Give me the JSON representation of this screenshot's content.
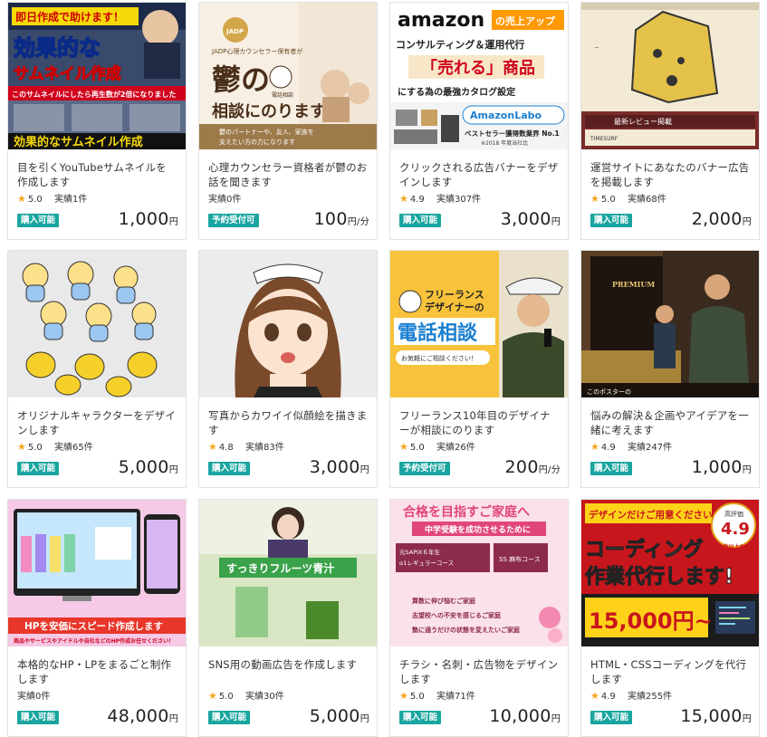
{
  "services": [
    {
      "title": "目を引くYouTubeサムネイルを作成します",
      "rating": "5.0",
      "sales_prefix": "実績",
      "sales_count": "1件",
      "badge": "購入可能",
      "price": "1,000",
      "unit": "円",
      "thumb": {
        "line1": "即日作成で助けます！",
        "line2": "効果的な",
        "line3": "サムネイル作成",
        "line4": "このサムネイルにしたら再生数が2倍になりました",
        "line5": "効果的なサムネイル作成"
      }
    },
    {
      "title": "心理カウンセラー資格者が鬱のお話を聞きます",
      "rating": "",
      "sales_prefix": "実績",
      "sales_count": "0件",
      "badge": "予約受付可",
      "price": "100",
      "unit": "円/分",
      "thumb": {
        "line1": "JADP心理カウンセラー保有者が",
        "line2": "鬱の",
        "line3": "相談にのります",
        "line4": "鬱のパートナーや、友人、家族を",
        "line5": "支えたい方の力になります",
        "line6": "電話相談",
        "seal": "JADP"
      }
    },
    {
      "title": "クリックされる広告バナーをデザインします",
      "rating": "4.9",
      "sales_prefix": "実績",
      "sales_count": "307件",
      "badge": "購入可能",
      "price": "3,000",
      "unit": "円",
      "thumb": {
        "line1": "amazon",
        "line2": "の売上アップ",
        "line3": "コンサルティング＆運用代行",
        "line4": "「売れる」商品",
        "line5": "にする為の最強カタログ設定",
        "line6": "AmazonLabo",
        "line7": "ベストセラー獲得数業界 No.1",
        "line8": "※2018 年度当社比"
      }
    },
    {
      "title": "運営サイトにあなたのバナー広告を掲載します",
      "rating": "5.0",
      "sales_prefix": "実績",
      "sales_count": "68件",
      "badge": "購入可能",
      "price": "2,000",
      "unit": "円",
      "thumb": {
        "line1": "最新レビュー掲載",
        "line2": "TIMESURF"
      }
    },
    {
      "title": "オリジナルキャラクターをデザインします",
      "rating": "5.0",
      "sales_prefix": "実績",
      "sales_count": "65件",
      "badge": "購入可能",
      "price": "5,000",
      "unit": "円",
      "thumb": {}
    },
    {
      "title": "写真からカワイイ似顔絵を描きます",
      "rating": "4.8",
      "sales_prefix": "実績",
      "sales_count": "83件",
      "badge": "購入可能",
      "price": "3,000",
      "unit": "円",
      "thumb": {}
    },
    {
      "title": "フリーランス10年目のデザイナーが相談にのります",
      "rating": "5.0",
      "sales_prefix": "実績",
      "sales_count": "26件",
      "badge": "予約受付可",
      "price": "200",
      "unit": "円/分",
      "thumb": {
        "line1": "フリーランス",
        "line2": "デザイナーの",
        "line3": "電話相談",
        "line4": "お気軽にご相談ください！"
      }
    },
    {
      "title": "悩みの解決＆企画やアイデアを一緒に考えます",
      "rating": "4.9",
      "sales_prefix": "実績",
      "sales_count": "247件",
      "badge": "購入可能",
      "price": "1,000",
      "unit": "円",
      "thumb": {
        "line1": "PREMIUM",
        "line2": "このポスターの"
      }
    },
    {
      "title": "本格的なHP・LPをまるごと制作します",
      "rating": "",
      "sales_prefix": "実績",
      "sales_count": "0件",
      "badge": "購入可能",
      "price": "48,000",
      "unit": "円",
      "thumb": {
        "line1": "HPを安価にスピード作成します",
        "line2": "商品やサービスやアイドルや自社などのHP作成お任せください！"
      }
    },
    {
      "title": "SNS用の動画広告を作成します",
      "rating": "5.0",
      "sales_prefix": "実績",
      "sales_count": "30件",
      "badge": "購入可能",
      "price": "5,000",
      "unit": "円",
      "thumb": {
        "line1": "すっきりフルーツ青汁"
      }
    },
    {
      "title": "チラシ・名刺・広告物をデザインします",
      "rating": "5.0",
      "sales_prefix": "実績",
      "sales_count": "71件",
      "badge": "購入可能",
      "price": "10,000",
      "unit": "円",
      "thumb": {
        "line1": "合格を目指すご家庭へ",
        "line2": "中学受験を成功させるために",
        "line3": "元SAPIX６年生α1レギュラーコース",
        "line4": "SS 麻布コース",
        "line5": "算数に伸び悩むご家庭",
        "line6": "志望校への不安を感じるご家庭",
        "line7": "塾に通うだけの状態を変えたいご家庭"
      }
    },
    {
      "title": "HTML・CSSコーディングを代行します",
      "rating": "4.9",
      "sales_prefix": "実績",
      "sales_count": "255件",
      "badge": "購入可能",
      "price": "15,000",
      "unit": "円",
      "thumb": {
        "line1": "デザインだけご用意ください",
        "line2": "コーディング",
        "line3": "作業代行します!",
        "line4": "15,000円~",
        "line5": "高評価",
        "line6": "4.9",
        "line7": "250件以上の実績あり"
      }
    }
  ],
  "colors": {
    "badge": "#1aa5a0",
    "star": "#f5a623",
    "border": "#e2e2e2"
  }
}
